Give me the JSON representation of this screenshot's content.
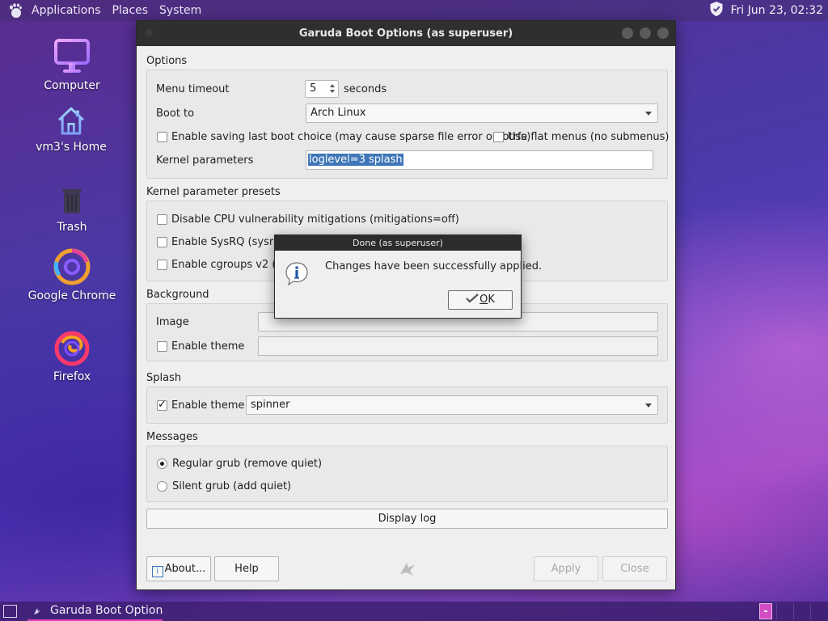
{
  "top_panel": {
    "menus": [
      "Applications",
      "Places",
      "System"
    ],
    "clock": "Fri Jun 23, 02:32"
  },
  "desktop": {
    "icons": [
      {
        "label": "Computer",
        "icon": "monitor-icon"
      },
      {
        "label": "vm3's Home",
        "icon": "home-icon"
      },
      {
        "label": "Trash",
        "icon": "trash-icon"
      },
      {
        "label": "Google Chrome",
        "icon": "chrome-icon"
      },
      {
        "label": "Firefox",
        "icon": "firefox-icon"
      }
    ]
  },
  "window": {
    "title": "Garuda Boot Options (as superuser)",
    "options": {
      "heading": "Options",
      "menu_timeout_label": "Menu timeout",
      "menu_timeout_value": "5",
      "menu_timeout_unit": "seconds",
      "boot_to_label": "Boot to",
      "boot_to_value": "Arch Linux",
      "save_last_label": "Enable saving last boot choice (may cause sparse file error on btrfs)",
      "save_last_checked": false,
      "flat_menus_label": "Use flat menus (no submenus)",
      "flat_menus_checked": false,
      "kernel_params_label": "Kernel parameters",
      "kernel_params_value": "loglevel=3 splash"
    },
    "presets": {
      "heading": "Kernel parameter presets",
      "items": [
        {
          "label": "Disable CPU vulnerability mitigations (mitigations=off)",
          "checked": false
        },
        {
          "label": "Enable SysRQ (sysrq_a",
          "checked": false
        },
        {
          "label": "Enable cgroups v2 (sys",
          "checked": false
        }
      ]
    },
    "background": {
      "heading": "Background",
      "image_label": "Image",
      "image_value": "",
      "theme_label": "Enable theme",
      "theme_checked": false,
      "theme_value": ""
    },
    "splash": {
      "heading": "Splash",
      "theme_label": "Enable theme",
      "theme_checked": true,
      "theme_value": "spinner"
    },
    "messages": {
      "heading": "Messages",
      "options": [
        {
          "label": "Regular grub (remove quiet)",
          "selected": true
        },
        {
          "label": "Silent grub (add quiet)",
          "selected": false
        }
      ]
    },
    "display_log_label": "Display log",
    "buttons": {
      "about": "About...",
      "help": "Help",
      "apply": "Apply",
      "close": "Close"
    }
  },
  "dialog": {
    "title": "Done (as superuser)",
    "message": "Changes have been successfully applied.",
    "ok_mnemonic": "O",
    "ok_rest": "K"
  },
  "taskbar": {
    "task_label": "Garuda Boot Option..."
  },
  "colors": {
    "selection": "#3e76b7",
    "taskbar_accent": "#e43fbf"
  }
}
